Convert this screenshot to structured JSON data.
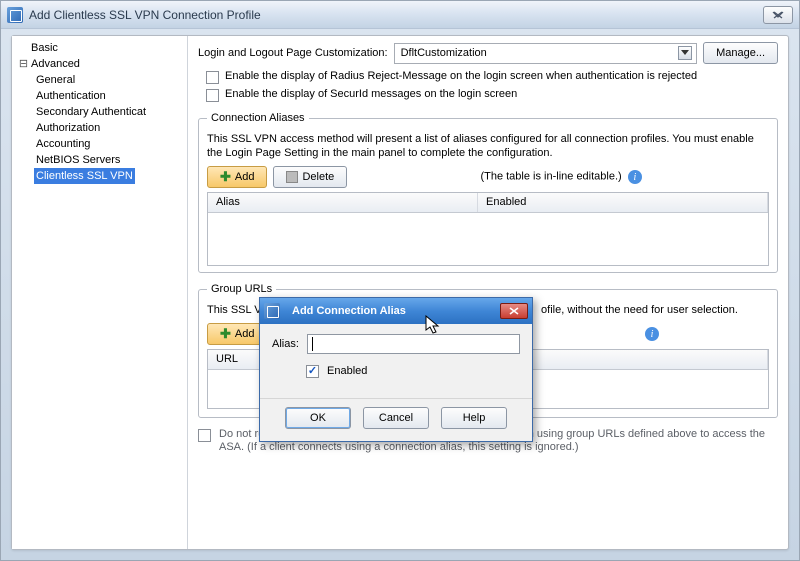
{
  "window": {
    "title": "Add Clientless SSL VPN Connection Profile"
  },
  "tree": {
    "basic": "Basic",
    "advanced": "Advanced",
    "items": [
      "General",
      "Authentication",
      "Secondary Authenticat",
      "Authorization",
      "Accounting",
      "NetBIOS Servers",
      "Clientless SSL VPN"
    ],
    "selectedIndex": 6
  },
  "top": {
    "customLabel": "Login and Logout Page Customization:",
    "customValue": "DfltCustomization",
    "manage": "Manage...",
    "chk1": "Enable the display of Radius Reject-Message on the login screen when authentication is rejected",
    "chk2": "Enable the display of SecurId messages on the login screen"
  },
  "aliases": {
    "legend": "Connection Aliases",
    "help": "This SSL VPN access method will present a list of aliases configured for all connection profiles. You must enable the Login Page Setting in the main panel to complete the configuration.",
    "add": "Add",
    "delete": "Delete",
    "inline": "(The table is in-line editable.)",
    "colAlias": "Alias",
    "colEnabled": "Enabled"
  },
  "urls": {
    "legend": "Group URLs",
    "helpPre": "This SSL VPN",
    "helpPost": "ofile, without the need for user selection.",
    "add": "Add",
    "colUrl": "URL"
  },
  "foot": {
    "text": "Do not run Cisco Secure Desktop (CSD) on client machine when using group URLs defined above to access the ASA. (If a client connects using a connection alias, this setting is ignored.)"
  },
  "modal": {
    "title": "Add Connection Alias",
    "aliasLabel": "Alias:",
    "aliasValue": "",
    "enabledLabel": "Enabled",
    "enabledChecked": true,
    "ok": "OK",
    "cancel": "Cancel",
    "help": "Help"
  }
}
